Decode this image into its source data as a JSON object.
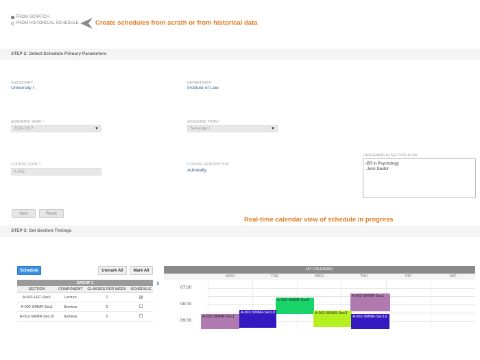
{
  "source": {
    "option_scratch": "FROM SCRATCH",
    "option_historical": "FROM HISTORICAL SCHEDULE",
    "callout": "Create schedules from scrath or from historical data"
  },
  "step2": {
    "title": "STEP 2: Select Schedule Primary Parameters",
    "subsidiary_label": "SUBSIDIARY",
    "subsidiary_value": "University I",
    "department_label": "DEPARTMENT",
    "department_value": "Institute of Law",
    "academic_year_label": "ACADEMIC YEAR",
    "academic_year_value": "2016-2017",
    "academic_term_label": "ACADEMIC TERM",
    "academic_term_value": "Semester I",
    "course_code_label": "COURSE CODE",
    "course_code_value": "A-002",
    "course_desc_label": "COURSE DESCRIPTION",
    "course_desc_value": "Admiralty",
    "programs_label": "PROGRAMS IN SECTION PLAN",
    "programs": [
      "-BS in Psychology",
      "-Juris Doctor"
    ],
    "required_mark": "*",
    "next_label": "Next",
    "reset_label": "Reset"
  },
  "callout2": "Real-time calendar view of schedule in progress",
  "step3": {
    "title": "STEP 3: Set Section Timings",
    "schedule_button": "Schedule",
    "unmark_all": "Unmark All",
    "mark_all": "Mark All",
    "group_title": "GROUP 1",
    "columns": [
      "SECTION",
      "COMPONENT",
      "CLASSES PER WEEK",
      "SCHEDULE"
    ],
    "rows": [
      {
        "section": "A-002-LEC-Sec1",
        "component": "Lecture",
        "classes": "2",
        "checked": "✔"
      },
      {
        "section": "A-002-SMNR-Sec1",
        "component": "Seminar",
        "classes": "2",
        "checked": ""
      },
      {
        "section": "A-002-SMNR-Sec10",
        "component": "Seminar",
        "classes": "2",
        "checked": ""
      }
    ]
  },
  "calendar": {
    "title": "MY CALENDAR",
    "days": [
      "MON",
      "TUE",
      "WED",
      "THU",
      "FRI",
      "SAT"
    ],
    "times": [
      "07:00",
      "08:00",
      "09:00"
    ],
    "events": [
      {
        "label": "A-002-SMNR-Sec9",
        "color": "#19d46a"
      },
      {
        "label": "A-002-SMNR-Sec1",
        "color": "#b07ab0"
      },
      {
        "label": "A-002-SMNR-Sec3",
        "color": "#b4f020"
      },
      {
        "label": "A-002-SMNR-Sec1",
        "color": "#b07ab0"
      },
      {
        "label": "A-002-SMNR-Sec10",
        "color": "#3419c0"
      },
      {
        "label": "A-002-SMNR-Sec10",
        "color": "#3419c0"
      }
    ]
  },
  "colors": {
    "accent_orange": "#e07a1f",
    "link_blue": "#2c5c8e",
    "button_blue": "#3b8fe0"
  }
}
